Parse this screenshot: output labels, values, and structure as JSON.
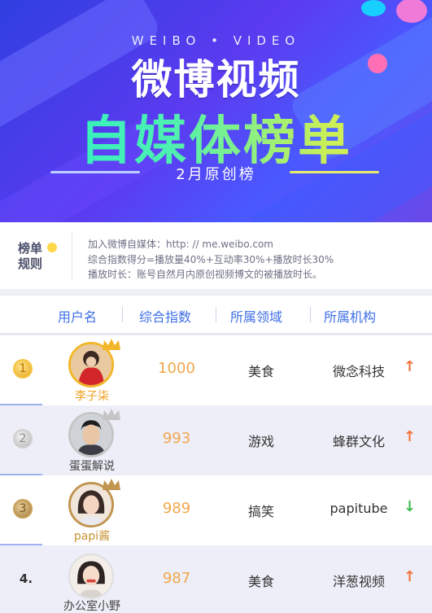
{
  "banner": {
    "subtitle_en": "WEIBO • VIDEO",
    "title_line1": "微博视频",
    "title_line2": "自媒体榜单",
    "subtitle_cn": "2月原创榜"
  },
  "rules": {
    "badge_line1": "榜单",
    "badge_line2": "规则",
    "lines": [
      "加入微博自媒体：http: // me.weibo.com",
      "综合指数得分=播放量40%+互动率30%+播放时长30%",
      "播放时长：账号自然月内原创视频博文的被播放时长。"
    ]
  },
  "table": {
    "headers": [
      "用户名",
      "综合指数",
      "所属领域",
      "所属机构"
    ],
    "rows": [
      {
        "rank": "1",
        "name": "李子柒",
        "score": "1000",
        "field": "美食",
        "org": "微念科技",
        "trend": "↑"
      },
      {
        "rank": "2",
        "name": "蛋蛋解说",
        "score": "993",
        "field": "游戏",
        "org": "蜂群文化",
        "trend": "↑"
      },
      {
        "rank": "3",
        "name": "papi酱",
        "score": "989",
        "field": "搞笑",
        "org": "papitube",
        "trend": "↓"
      },
      {
        "rank": "4.",
        "name": "办公室小野",
        "score": "987",
        "field": "美食",
        "org": "洋葱视频",
        "trend": "↑"
      }
    ]
  },
  "colors": {
    "accent_blue": "#3f6fe6",
    "score_orange": "#f2a64a",
    "trend_up": "#f5703a",
    "trend_down": "#3dbb4e"
  }
}
